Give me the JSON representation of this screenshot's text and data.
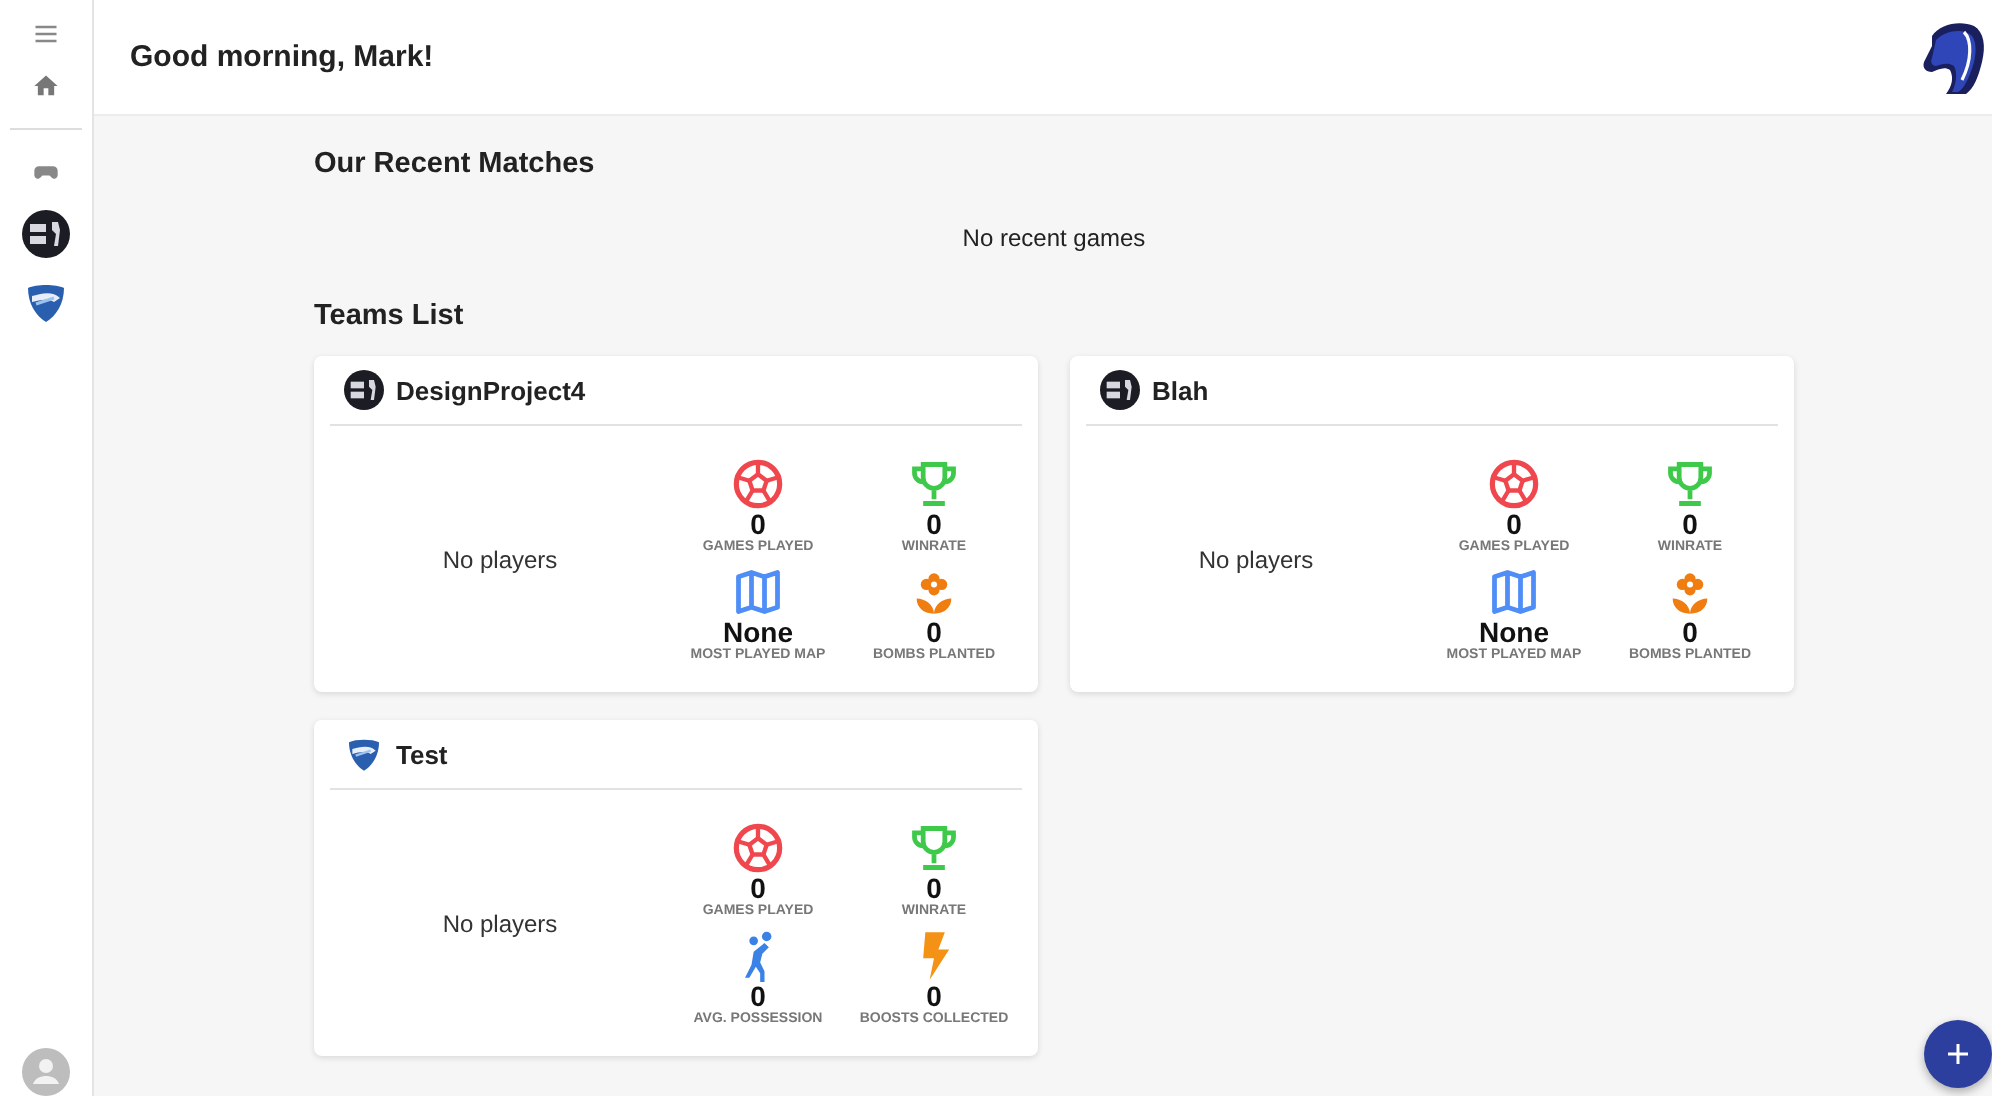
{
  "sidebar": {
    "games": [
      {
        "kind": "csgo"
      },
      {
        "kind": "rocket"
      }
    ]
  },
  "header": {
    "greeting": "Good morning, Mark!"
  },
  "recent_matches": {
    "title": "Our Recent Matches",
    "empty_text": "No recent games"
  },
  "teams_list": {
    "title": "Teams List",
    "teams": [
      {
        "name": "DesignProject4",
        "logo": {
          "kind": "csgo"
        },
        "players_text": "No players",
        "stats": [
          {
            "kind": "ball",
            "value": "0",
            "label": "GAMES PLAYED"
          },
          {
            "kind": "trophy",
            "value": "0",
            "label": "WINRATE"
          },
          {
            "kind": "map",
            "value": "None",
            "label": "MOST PLAYED MAP"
          },
          {
            "kind": "bomb",
            "value": "0",
            "label": "BOMBS PLANTED"
          }
        ]
      },
      {
        "name": "Blah",
        "logo": {
          "kind": "csgo"
        },
        "players_text": "No players",
        "stats": [
          {
            "kind": "ball",
            "value": "0",
            "label": "GAMES PLAYED"
          },
          {
            "kind": "trophy",
            "value": "0",
            "label": "WINRATE"
          },
          {
            "kind": "map",
            "value": "None",
            "label": "MOST PLAYED MAP"
          },
          {
            "kind": "bomb",
            "value": "0",
            "label": "BOMBS PLANTED"
          }
        ]
      },
      {
        "name": "Test",
        "logo": {
          "kind": "rocket"
        },
        "players_text": "No players",
        "stats": [
          {
            "kind": "ball",
            "value": "0",
            "label": "GAMES PLAYED"
          },
          {
            "kind": "trophy",
            "value": "0",
            "label": "WINRATE"
          },
          {
            "kind": "player",
            "value": "0",
            "label": "AVG. POSSESSION"
          },
          {
            "kind": "boost",
            "value": "0",
            "label": "BOOSTS COLLECTED"
          }
        ]
      }
    ]
  }
}
